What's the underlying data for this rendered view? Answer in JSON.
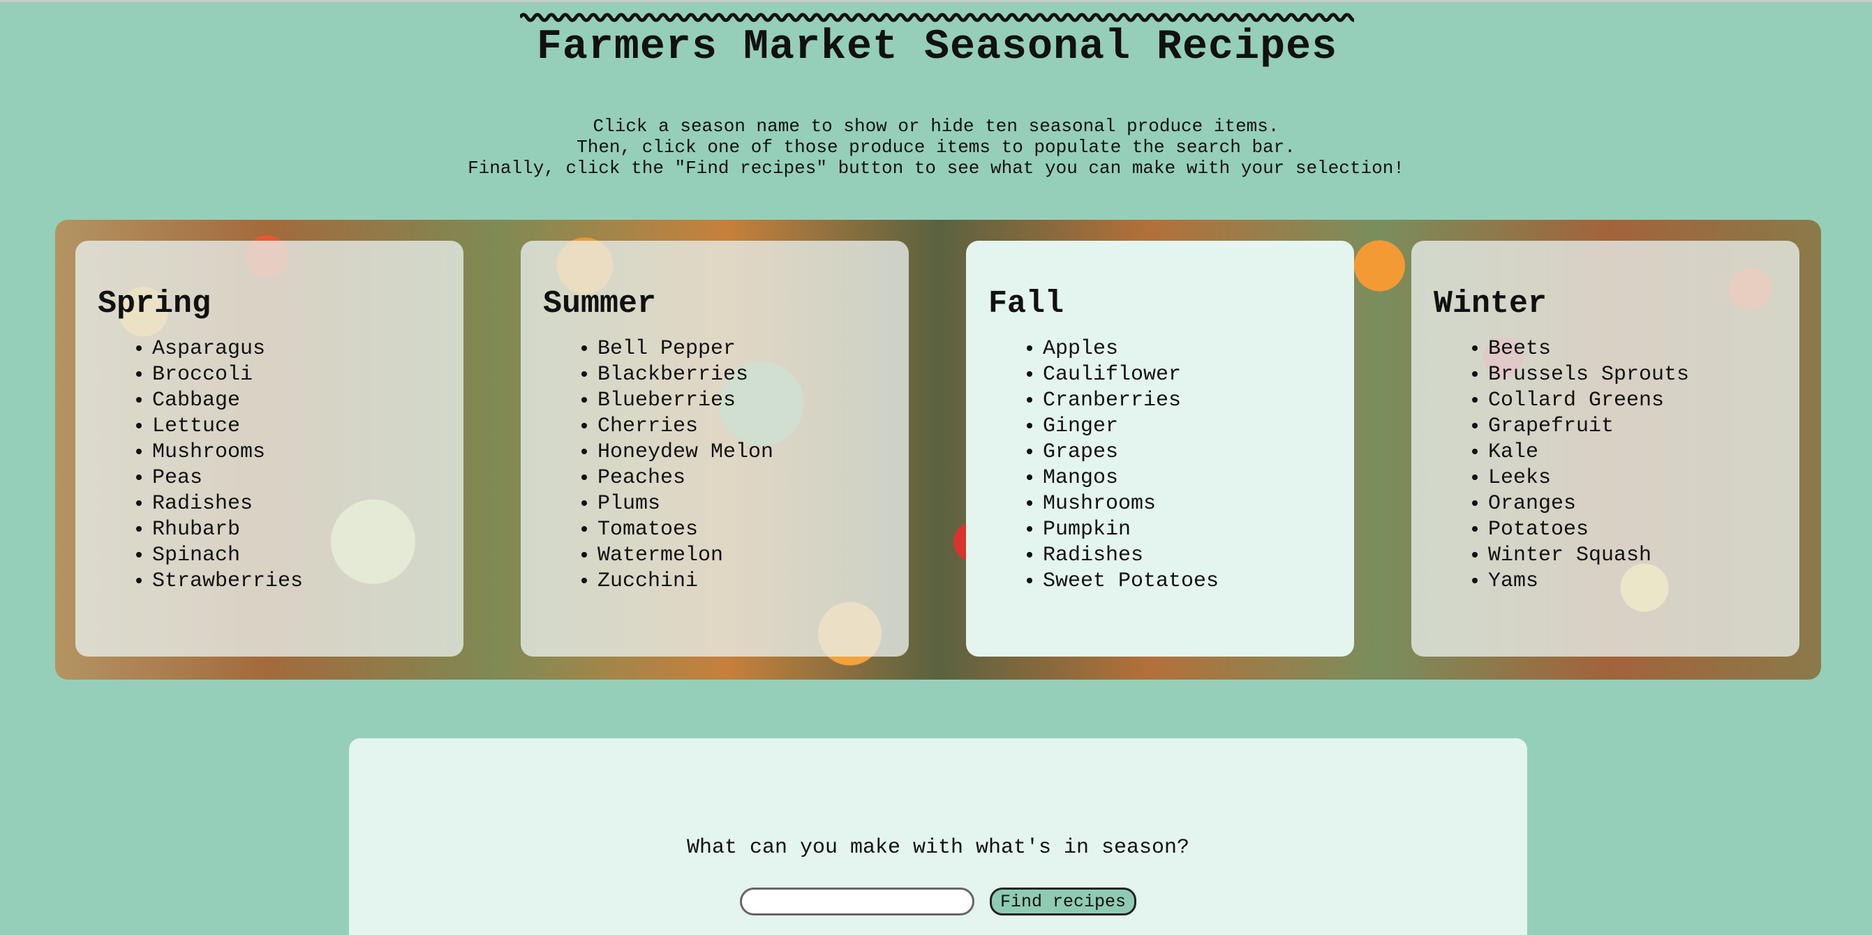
{
  "header": {
    "title": "Farmers Market Seasonal Recipes"
  },
  "instructions": [
    "Click a season name to show or hide ten seasonal produce items.",
    "Then, click one of those produce items to populate the search bar.",
    "Finally, click the \"Find recipes\" button to see what you can make with your selection!"
  ],
  "seasons": [
    {
      "name": "Spring",
      "items": [
        "Asparagus",
        "Broccoli",
        "Cabbage",
        "Lettuce",
        "Mushrooms",
        "Peas",
        "Radishes",
        "Rhubarb",
        "Spinach",
        "Strawberries"
      ]
    },
    {
      "name": "Summer",
      "items": [
        "Bell Pepper",
        "Blackberries",
        "Blueberries",
        "Cherries",
        "Honeydew Melon",
        "Peaches",
        "Plums",
        "Tomatoes",
        "Watermelon",
        "Zucchini"
      ]
    },
    {
      "name": "Fall",
      "items": [
        "Apples",
        "Cauliflower",
        "Cranberries",
        "Ginger",
        "Grapes",
        "Mangos",
        "Mushrooms",
        "Pumpkin",
        "Radishes",
        "Sweet Potatoes"
      ]
    },
    {
      "name": "Winter",
      "items": [
        "Beets",
        "Brussels Sprouts",
        "Collard Greens",
        "Grapefruit",
        "Kale",
        "Leeks",
        "Oranges",
        "Potatoes",
        "Winter Squash",
        "Yams"
      ]
    }
  ],
  "search": {
    "prompt": "What can you make with what's in season?",
    "value": "",
    "button_label": "Find recipes"
  },
  "colors": {
    "background": "#95cfb9",
    "panel": "#e4f4ee",
    "button": "#8fcbb3"
  }
}
